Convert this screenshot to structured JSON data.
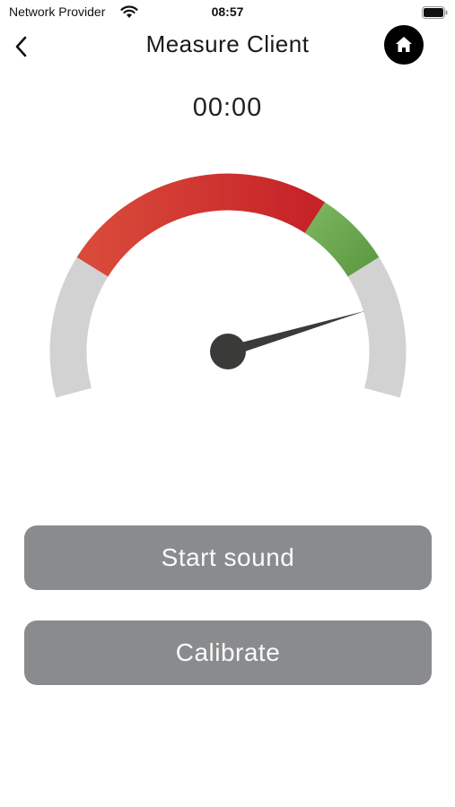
{
  "status_bar": {
    "carrier": "Network Provider",
    "time": "08:57",
    "wifi_icon": "wifi-icon",
    "battery_icon": "battery-icon"
  },
  "header": {
    "title": "Measure Client",
    "back_icon": "chevron-left-icon",
    "home_icon": "home-icon"
  },
  "timer": {
    "value": "00:00"
  },
  "gauge": {
    "needle_level": 0.85,
    "colors": {
      "neutral": "#d2d2d2",
      "red": "#c9262a",
      "green": "#6aa84f",
      "needle": "#3a3a38"
    }
  },
  "actions": {
    "start_label": "Start sound",
    "calibrate_label": "Calibrate"
  },
  "colors": {
    "button_bg": "#8a8b8d",
    "button_text": "#fafafa",
    "home_bg": "#000000"
  }
}
